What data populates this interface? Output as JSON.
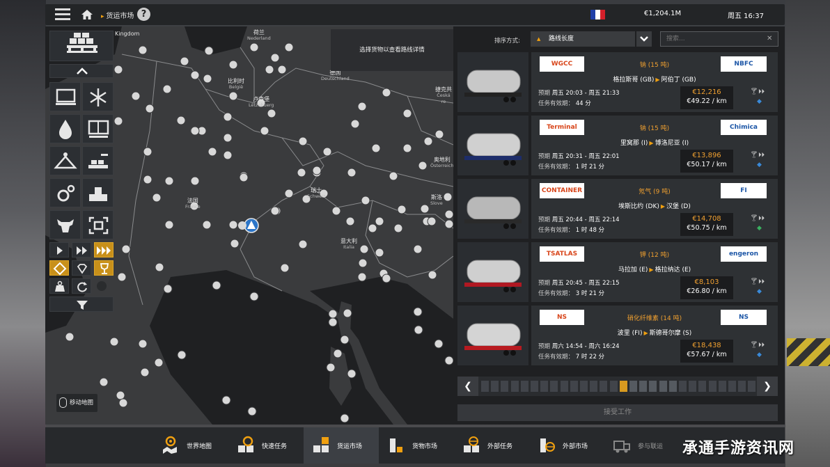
{
  "topbar": {
    "breadcrumb": "货运市场",
    "help": "?",
    "money": "€1,204.1M",
    "time": "周五 16:37"
  },
  "map": {
    "tooltip": "选择货物以查看路线详情",
    "move_hint": "移动地图",
    "labels": [
      {
        "text": "Kingdom",
        "sub": ""
      },
      {
        "text": "荷兰",
        "sub": "Nederland"
      },
      {
        "text": "德国",
        "sub": "Deutschland"
      },
      {
        "text": "比利时",
        "sub": "België"
      },
      {
        "text": "卢森堡",
        "sub": "Lëtzebuerg"
      },
      {
        "text": "捷克共",
        "sub": "Česká re"
      },
      {
        "text": "奥地利",
        "sub": "Österreich"
      },
      {
        "text": "瑞士",
        "sub": "Schweiz"
      },
      {
        "text": "法国",
        "sub": "France"
      },
      {
        "text": "斯洛",
        "sub": "Slove"
      },
      {
        "text": "意大利",
        "sub": "Italia"
      }
    ]
  },
  "sort": {
    "label": "排序方式:",
    "value": "路线长度",
    "search_placeholder": "搜索..."
  },
  "jobs": [
    {
      "cargo": "钠 (15 吨)",
      "from": "格拉斯哥 (GB)",
      "to": "阿伯丁 (GB)",
      "eta_label": "预期",
      "eta": "周五 20:03 - 周五 21:33",
      "valid_label": "任务有效期：",
      "valid": "44 分",
      "price": "€12,216",
      "per_km": "€49.22 / km",
      "logo_left": "WGCC",
      "logo_right": "NBFC"
    },
    {
      "cargo": "钠 (15 吨)",
      "from": "里窝那 (I)",
      "to": "博洛尼亚 (I)",
      "eta_label": "预期",
      "eta": "周五 20:31 - 周五 22:01",
      "valid_label": "任务有效期：",
      "valid": "1 时 21 分",
      "price": "€13,896",
      "per_km": "€50.17 / km",
      "logo_left": "Terminal container",
      "logo_right": "Chimica Italia s.r.l."
    },
    {
      "cargo": "氖气 (9 吨)",
      "from": "埃斯比约 (DK)",
      "to": "汉堡 (D)",
      "eta_label": "预期",
      "eta": "周五 20:44 - 周五 22:14",
      "valid_label": "任务有效期：",
      "valid": "1 时 48 分",
      "price": "€14,708",
      "per_km": "€50.75 / km",
      "logo_left": "CONTAINER PORT",
      "logo_right": "FI"
    },
    {
      "cargo": "钾 (12 吨)",
      "from": "马拉加 (E)",
      "to": "格拉纳达 (E)",
      "eta_label": "预期",
      "eta": "周五 20:45 - 周五 22:15",
      "valid_label": "任务有效期：",
      "valid": "3 时 21 分",
      "price": "€8,103",
      "per_km": "€26.80 / km",
      "logo_left": "TSATLAS",
      "logo_right": "engeron"
    },
    {
      "cargo": "硝化纤维素 (14 吨)",
      "from": "波里 (FI)",
      "to": "斯德哥尔摩 (S)",
      "eta_label": "预期",
      "eta": "周六 14:54 - 周六 16:24",
      "valid_label": "任务有效期：",
      "valid": "7 时 22 分",
      "price": "€18,438",
      "per_km": "€57.67 / km",
      "logo_left": "NS CHEMICALS",
      "logo_right": "NS CHEMICALS"
    }
  ],
  "pager": {
    "pages": 28,
    "current": 14
  },
  "accept_label": "接受工作",
  "tabs": [
    {
      "label": "世界地图",
      "icon": "world-map-icon"
    },
    {
      "label": "快速任务",
      "icon": "quick-job-icon"
    },
    {
      "label": "货运市场",
      "icon": "freight-market-icon"
    },
    {
      "label": "货物市场",
      "icon": "cargo-market-icon"
    },
    {
      "label": "外部任务",
      "icon": "external-jobs-icon"
    },
    {
      "label": "外部市场",
      "icon": "external-market-icon"
    },
    {
      "label": "参与联运",
      "icon": "convoy-icon"
    }
  ],
  "watermark": "承通手游资讯网",
  "colors": {
    "accent": "#f0a010",
    "panel": "#1f2022",
    "price": "#f0a030"
  }
}
